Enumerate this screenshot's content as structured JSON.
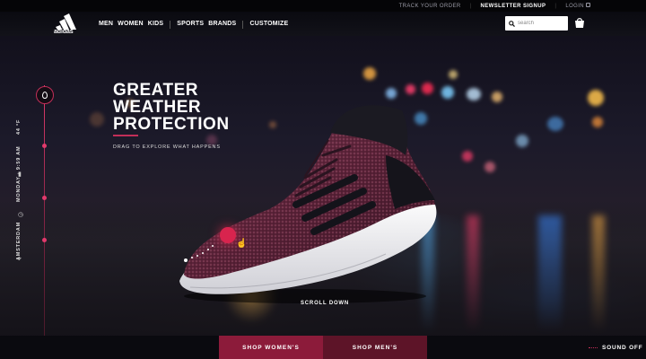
{
  "utility": {
    "track_order": "TRACK YOUR ORDER",
    "newsletter": "NEWSLETTER SIGNUP",
    "login": "LOGIN"
  },
  "nav": {
    "logo_text": "adidas",
    "links": [
      "MEN",
      "WOMEN",
      "KIDS",
      "SPORTS",
      "BRANDS",
      "CUSTOMIZE"
    ],
    "search_placeholder": "search"
  },
  "hero": {
    "headline": [
      "GREATER",
      "WEATHER",
      "PROTECTION"
    ],
    "subtext": "DRAG TO EXPLORE WHAT HAPPENS",
    "scroll_label": "SCROLL DOWN",
    "rail": {
      "temperature": "44 °F",
      "time": "MONDAY · 9:59 AM",
      "city": "AMSTERDAM"
    }
  },
  "bottom": {
    "shop_womens": "SHOP WOMEN'S",
    "shop_mens": "SHOP MEN'S",
    "sound": "SOUND OFF"
  },
  "colors": {
    "accent": "#c22e58",
    "womens_btn": "#8c1b3a",
    "mens_btn": "#5d1428"
  }
}
